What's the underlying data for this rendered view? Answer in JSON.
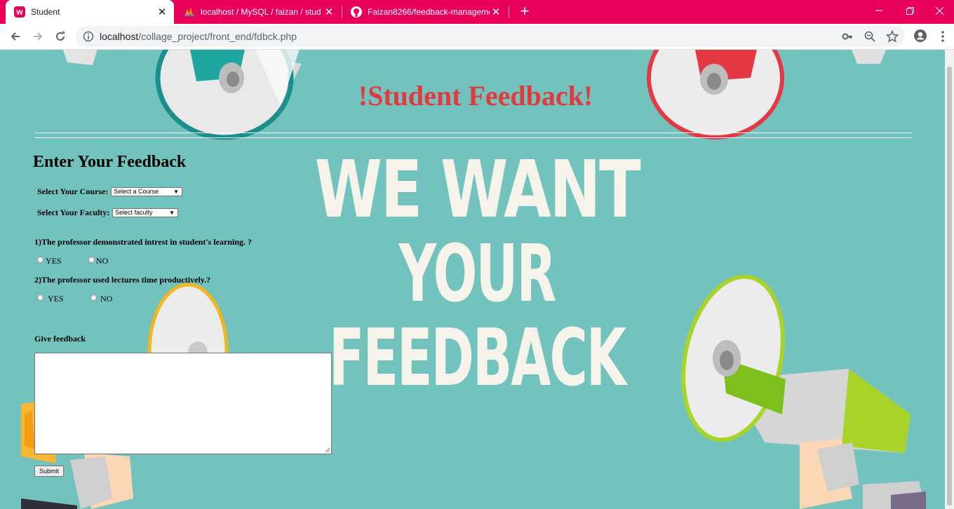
{
  "browser": {
    "tabs": [
      {
        "title": "Student",
        "active": true
      },
      {
        "title": "localhost / MySQL / faizan / stud",
        "active": false
      },
      {
        "title": "Faizan8266/feedback-manageme",
        "active": false
      }
    ],
    "url_host": "localhost",
    "url_path": "/collage_project/front_end/fdbck.php",
    "accent": "#e8005a"
  },
  "page": {
    "title": "!Student Feedback!",
    "hero_line1": "WE WANT",
    "hero_line2": "YOUR FEEDBACK",
    "form_heading": "Enter Your Feedback",
    "course_label": "Select Your Course:",
    "course_selected": "Select a Course",
    "faculty_label": "Select Your Faculty:",
    "faculty_selected": "Select faculty",
    "questions": [
      {
        "text": "1)The professor demonstrated intrest in student's learning. ?",
        "yes": "YES",
        "no": "NO"
      },
      {
        "text": "2)The professor used lectures time productively.?",
        "yes": "YES",
        "no": "NO"
      }
    ],
    "feedback_label": "Give feedback",
    "submit_label": "Submit",
    "colors": {
      "background": "#72c2be",
      "title": "#e0393e"
    }
  }
}
